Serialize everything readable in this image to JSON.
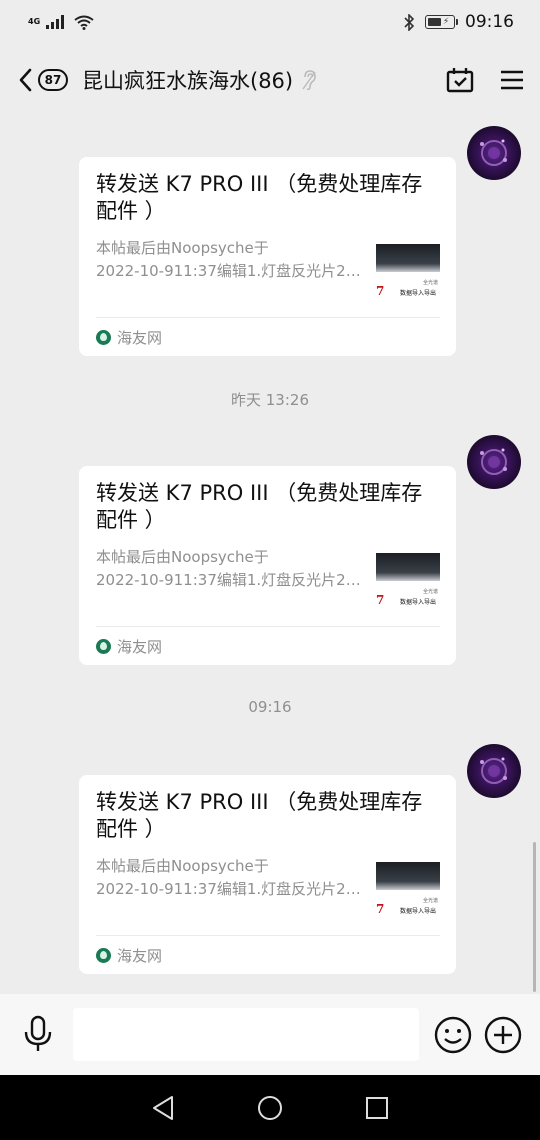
{
  "status_bar": {
    "network": "4G",
    "time": "09:16"
  },
  "header": {
    "unread_count": "87",
    "title": "昆山疯狂水族海水(86)"
  },
  "messages": [
    {
      "title": "转发送 K7 PRO III （免费处理库存配件 ）",
      "desc_line1": "本帖最后由Noopsyche于",
      "desc_line2": "2022-10-911:37编辑1.灯盘反光片2....",
      "thumb_brand": "7",
      "thumb_text": "数据导入导出",
      "thumb_small": "全光谱",
      "source": "海友网"
    },
    {
      "title": "转发送 K7 PRO III （免费处理库存配件 ）",
      "desc_line1": "本帖最后由Noopsyche于",
      "desc_line2": "2022-10-911:37编辑1.灯盘反光片2....",
      "thumb_brand": "7",
      "thumb_text": "数据导入导出",
      "thumb_small": "全光谱",
      "source": "海友网"
    },
    {
      "title": "转发送 K7 PRO III （免费处理库存配件 ）",
      "desc_line1": "本帖最后由Noopsyche于",
      "desc_line2": "2022-10-911:37编辑1.灯盘反光片2....",
      "thumb_brand": "7",
      "thumb_text": "数据导入导出",
      "thumb_small": "全光谱",
      "source": "海友网"
    }
  ],
  "timestamps": [
    "昨天 13:26",
    "09:16"
  ],
  "input": {
    "placeholder": ""
  },
  "icons": {
    "bluetooth": "bluetooth-icon",
    "wifi": "wifi-icon",
    "back": "chevron-left-icon",
    "mute": "ear-icon",
    "calendar": "calendar-check-icon",
    "menu": "hamburger-menu-icon",
    "voice": "microphone-icon",
    "emoji": "smiley-icon",
    "more": "plus-circle-icon"
  },
  "colors": {
    "background": "#ededed",
    "card": "#ffffff",
    "meta_text": "#8f8f8f",
    "source_icon": "#1a7a55"
  }
}
